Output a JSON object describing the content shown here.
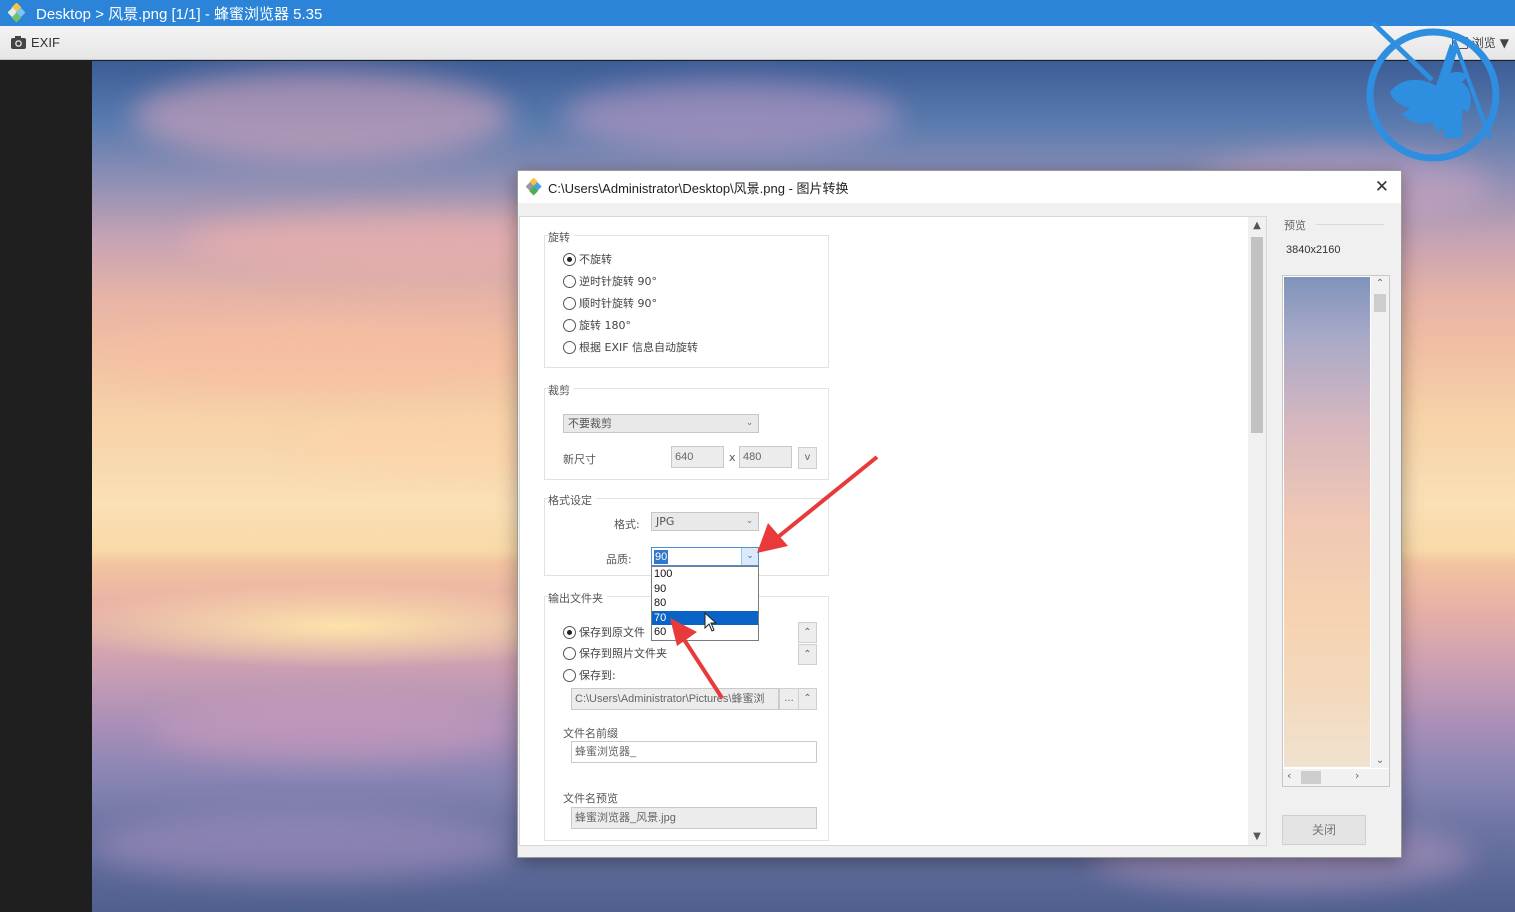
{
  "window": {
    "title": "Desktop > 风景.png [1/1] - 蜂蜜浏览器 5.35",
    "accent": "#2b84d8"
  },
  "toolbar": {
    "exif_label": "EXIF",
    "browse_label": "浏览"
  },
  "dialog": {
    "title": "C:\\Users\\Administrator\\Desktop\\风景.png - 图片转换",
    "rotate": {
      "label": "旋转",
      "options": [
        "不旋转",
        "逆时针旋转 90°",
        "顺时针旋转 90°",
        "旋转 180°",
        "根据 EXIF 信息自动旋转"
      ],
      "selected": "不旋转"
    },
    "crop": {
      "label": "裁剪",
      "mode": "不要裁剪",
      "size_label": "新尺寸",
      "width": "640",
      "x_sep": "x",
      "height": "480",
      "button": "v"
    },
    "format": {
      "label": "格式设定",
      "format_label": "格式:",
      "format_value": "JPG",
      "quality_label": "品质:",
      "quality_value": "90",
      "quality_options": [
        "100",
        "90",
        "80",
        "70",
        "60"
      ],
      "highlighted_option": "70"
    },
    "output": {
      "label": "输出文件夹",
      "options": [
        "保存到原文件",
        "保存到照片文件夹",
        "保存到:"
      ],
      "selected": "保存到原文件",
      "path": "C:\\Users\\Administrator\\Pictures\\蜂蜜浏",
      "browse_btn": "...",
      "prefix_label": "文件名前缀",
      "prefix_value": "蜂蜜浏览器_",
      "preview_label": "文件名预览",
      "preview_value": "蜂蜜浏览器_风景.jpg"
    },
    "preview": {
      "label": "预览",
      "resolution": "3840x2160"
    },
    "close_label": "关闭"
  }
}
